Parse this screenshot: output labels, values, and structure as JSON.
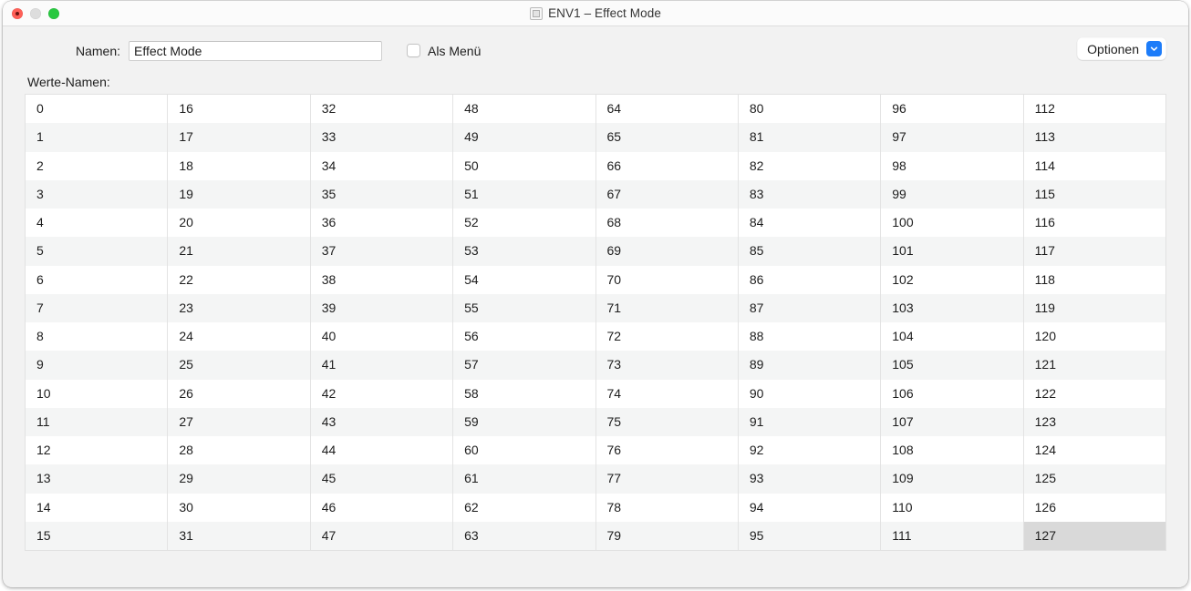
{
  "window": {
    "title": "ENV1 – Effect Mode",
    "title_icon": "window-document-icon",
    "traffic_lights": {
      "close": "close-button",
      "minimize": "minimize-button",
      "maximize": "maximize-button"
    }
  },
  "form": {
    "name_label": "Namen:",
    "name_value": "Effect Mode",
    "name_placeholder": "",
    "checkbox_label": "Als Menü",
    "checkbox_checked": false,
    "options_button_label": "Optionen",
    "options_chevron_icon": "chevron-down-icon",
    "options_accent_color": "#1d7cf9"
  },
  "values_table": {
    "label": "Werte-Namen:",
    "selected_value": "127",
    "columns": [
      [
        "0",
        "1",
        "2",
        "3",
        "4",
        "5",
        "6",
        "7",
        "8",
        "9",
        "10",
        "11",
        "12",
        "13",
        "14",
        "15"
      ],
      [
        "16",
        "17",
        "18",
        "19",
        "20",
        "21",
        "22",
        "23",
        "24",
        "25",
        "26",
        "27",
        "28",
        "29",
        "30",
        "31"
      ],
      [
        "32",
        "33",
        "34",
        "35",
        "36",
        "37",
        "38",
        "39",
        "40",
        "41",
        "42",
        "43",
        "44",
        "45",
        "46",
        "47"
      ],
      [
        "48",
        "49",
        "50",
        "51",
        "52",
        "53",
        "54",
        "55",
        "56",
        "57",
        "58",
        "59",
        "60",
        "61",
        "62",
        "63"
      ],
      [
        "64",
        "65",
        "66",
        "67",
        "68",
        "69",
        "70",
        "71",
        "72",
        "73",
        "74",
        "75",
        "76",
        "77",
        "78",
        "79"
      ],
      [
        "80",
        "81",
        "82",
        "83",
        "84",
        "85",
        "86",
        "87",
        "88",
        "89",
        "90",
        "91",
        "92",
        "93",
        "94",
        "95"
      ],
      [
        "96",
        "97",
        "98",
        "99",
        "100",
        "101",
        "102",
        "103",
        "104",
        "105",
        "106",
        "107",
        "108",
        "109",
        "110",
        "111"
      ],
      [
        "112",
        "113",
        "114",
        "115",
        "116",
        "117",
        "118",
        "119",
        "120",
        "121",
        "122",
        "123",
        "124",
        "125",
        "126",
        "127"
      ]
    ]
  }
}
